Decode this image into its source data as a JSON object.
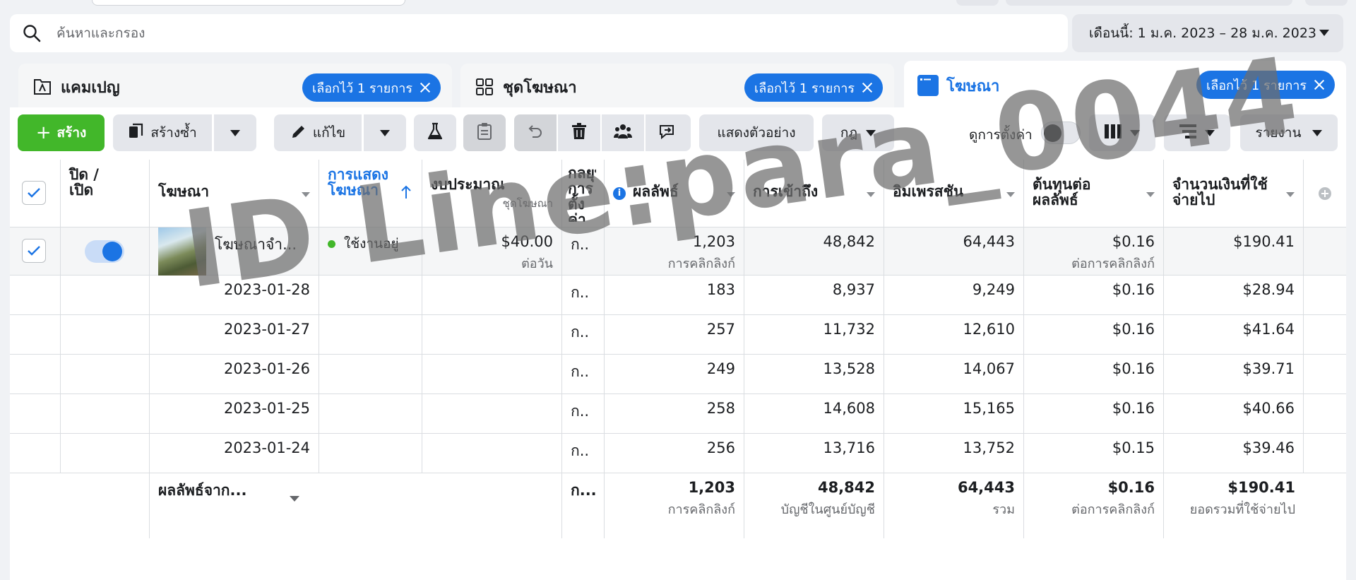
{
  "search": {
    "placeholder": "ค้นหาและกรอง"
  },
  "date_range": {
    "label": "เดือนนี้: 1 ม.ค. 2023 – 28 ม.ค. 2023"
  },
  "tabs": [
    {
      "label": "แคมเปญ",
      "chip": "เลือกไว้ 1 รายการ"
    },
    {
      "label": "ชุดโฆษณา",
      "chip": "เลือกไว้ 1 รายการ"
    },
    {
      "label": "โฆษณา",
      "chip": "เลือกไว้ 1 รายการ"
    }
  ],
  "toolbar": {
    "create": "สร้าง",
    "duplicate": "สร้างซ้ำ",
    "edit": "แก้ไข",
    "preview": "แสดงตัวอย่าง",
    "rules": "กฎ",
    "view_settings": "ดูการตั้งค่า",
    "reports": "รายงาน"
  },
  "table": {
    "headers": {
      "onoff": "ปิด / เปิด",
      "ad": "โฆษณา",
      "delivery": "การแสดงโฆษณา",
      "budget": "งบประมาณ",
      "budget_sub": "ชุดโฆษณา",
      "bid": "กลยุทธ์การตั้งค่า",
      "results": "ผลลัพธ์",
      "reach": "การเข้าถึง",
      "impressions": "อิมเพรสชัน",
      "cpr": "ต้นทุนต่อผลลัพธ์",
      "spent": "จำนวนเงินที่ใช้จ่ายไป"
    },
    "main_row": {
      "ad_name": "โฆษณาจำ...",
      "delivery": "ใช้งานอยู่",
      "budget": "$40.00",
      "budget_sub": "ต่อวัน",
      "bid": "ก..",
      "results": "1,203",
      "results_sub": "การคลิกลิงก์",
      "reach": "48,842",
      "impressions": "64,443",
      "cpr": "$0.16",
      "cpr_sub": "ต่อการคลิกลิงก์",
      "spent": "$190.41"
    },
    "rows": [
      {
        "date": "2023-01-28",
        "bid": "ก..",
        "results": "183",
        "reach": "8,937",
        "impressions": "9,249",
        "cpr": "$0.16",
        "spent": "$28.94"
      },
      {
        "date": "2023-01-27",
        "bid": "ก..",
        "results": "257",
        "reach": "11,732",
        "impressions": "12,610",
        "cpr": "$0.16",
        "spent": "$41.64"
      },
      {
        "date": "2023-01-26",
        "bid": "ก..",
        "results": "249",
        "reach": "13,528",
        "impressions": "14,067",
        "cpr": "$0.16",
        "spent": "$39.71"
      },
      {
        "date": "2023-01-25",
        "bid": "ก..",
        "results": "258",
        "reach": "14,608",
        "impressions": "15,165",
        "cpr": "$0.16",
        "spent": "$40.66"
      },
      {
        "date": "2023-01-24",
        "bid": "ก..",
        "results": "256",
        "reach": "13,716",
        "impressions": "13,752",
        "cpr": "$0.15",
        "spent": "$39.46"
      }
    ],
    "totals": {
      "label": "ผลลัพธ์จาก...",
      "bid": "ก...",
      "results": "1,203",
      "results_sub": "การคลิกลิงก์",
      "reach": "48,842",
      "reach_sub": "บัญชีในศูนย์บัญชี",
      "impressions": "64,443",
      "impressions_sub": "รวม",
      "cpr": "$0.16",
      "cpr_sub": "ต่อการคลิกลิงก์",
      "spent": "$190.41",
      "spent_sub": "ยอดรวมที่ใช้จ่ายไป"
    }
  },
  "watermark": "ID Line:para_0044",
  "colors": {
    "accent": "#1b74e4",
    "create_green": "#42b72a",
    "active_dot": "#42b72a"
  }
}
